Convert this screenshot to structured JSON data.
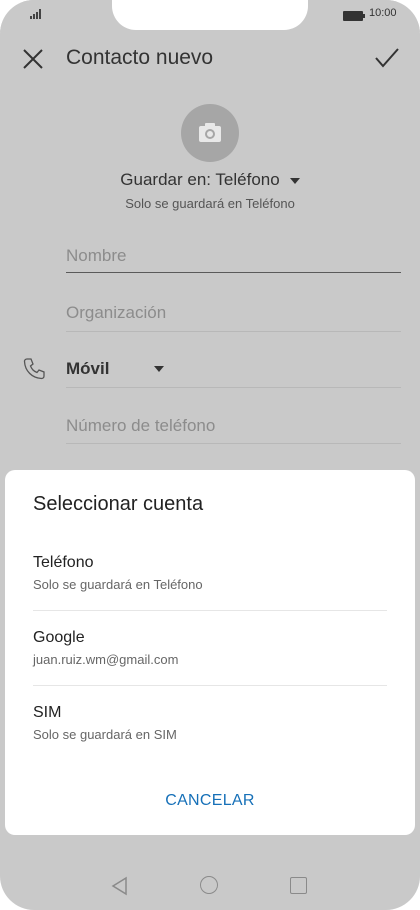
{
  "status_bar": {
    "time": "10:00",
    "signal_icon": "signal-icon",
    "battery_icon": "battery-icon"
  },
  "app_bar": {
    "title": "Contacto nuevo",
    "close_icon": "close-icon",
    "confirm_icon": "check-icon"
  },
  "contact_form": {
    "photo_icon": "camera-icon",
    "save_in_label": "Guardar en: Teléfono",
    "save_in_note": "Solo se guardará en Teléfono",
    "name_placeholder": "Nombre",
    "organization_placeholder": "Organización",
    "phone_type": "Móvil",
    "phone_placeholder": "Número de teléfono"
  },
  "account_dialog": {
    "title": "Seleccionar cuenta",
    "options": [
      {
        "label": "Teléfono",
        "detail": "Solo se guardará en Teléfono"
      },
      {
        "label": "Google",
        "detail": "juan.ruiz.wm@gmail.com"
      },
      {
        "label": "SIM",
        "detail": "Solo se guardará en SIM"
      }
    ],
    "cancel_label": "CANCELAR"
  },
  "colors": {
    "accent": "#1670b8",
    "scrim_background": "#c9c9c9",
    "dialog_background": "#ffffff"
  }
}
